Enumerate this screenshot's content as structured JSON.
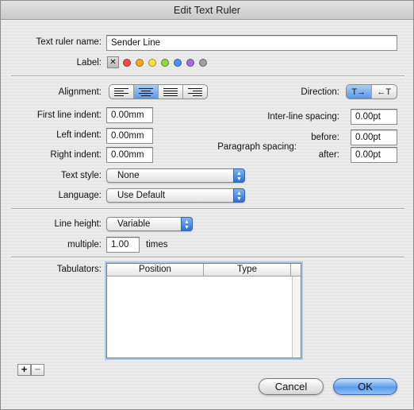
{
  "window": {
    "title": "Edit Text Ruler"
  },
  "ruler_name": {
    "label": "Text ruler name:",
    "value": "Sender Line"
  },
  "label_row": {
    "label": "Label:",
    "none_glyph": "✕",
    "colors": [
      "#ef4b4b",
      "#f5a623",
      "#f5e33b",
      "#8fd640",
      "#4f8ff3",
      "#a66ad9",
      "#a0a0a0"
    ]
  },
  "alignment": {
    "label": "Alignment:",
    "options": [
      "left",
      "center",
      "justify",
      "right"
    ],
    "selected": "center"
  },
  "direction": {
    "label": "Direction:",
    "options": [
      "T→",
      "←T"
    ],
    "selected": "T→"
  },
  "indents": {
    "first_line": {
      "label": "First line indent:",
      "value": "0.00mm"
    },
    "left": {
      "label": "Left indent:",
      "value": "0.00mm"
    },
    "right": {
      "label": "Right indent:",
      "value": "0.00mm"
    }
  },
  "spacing": {
    "inter_line_label": "Inter-line spacing:",
    "inter_line_value": "0.00pt",
    "paragraph_label": "Paragraph spacing:",
    "before_label": "before:",
    "before_value": "0.00pt",
    "after_label": "after:",
    "after_value": "0.00pt"
  },
  "text_style": {
    "label": "Text style:",
    "value": "None"
  },
  "language": {
    "label": "Language:",
    "value": "Use Default"
  },
  "line_height": {
    "label": "Line height:",
    "value": "Variable",
    "multiple_label": "multiple:",
    "multiple_value": "1.00",
    "times_label": "times"
  },
  "tabulators": {
    "label": "Tabulators:",
    "columns": [
      "Position",
      "Type"
    ]
  },
  "buttons": {
    "add": "+",
    "remove": "−",
    "cancel": "Cancel",
    "ok": "OK"
  }
}
